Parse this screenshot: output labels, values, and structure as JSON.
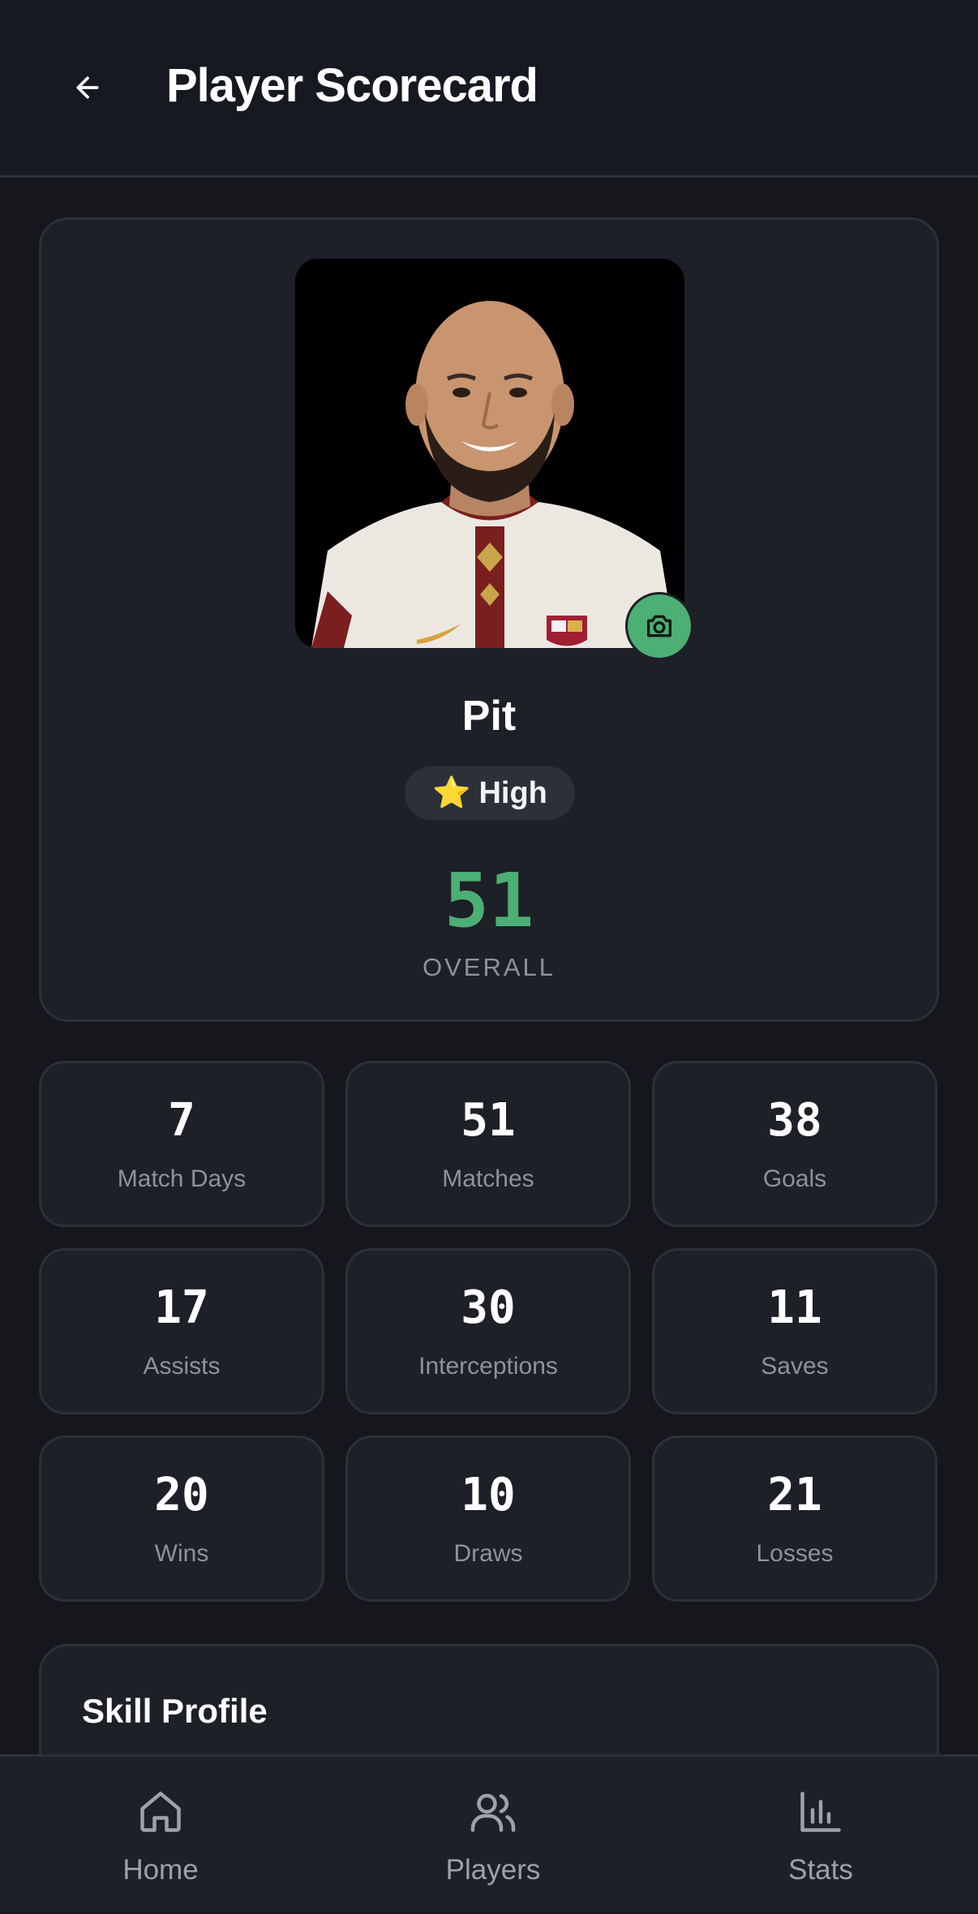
{
  "header": {
    "title": "Player Scorecard",
    "back_icon": "arrow-left-icon"
  },
  "profile": {
    "name": "Pit",
    "tier_emoji": "⭐",
    "tier_label": "High",
    "overall_value": "51",
    "overall_label": "OVERALL",
    "camera_icon": "camera-icon",
    "accent_color": "#4caf73"
  },
  "stats": [
    {
      "value": "7",
      "label": "Match Days"
    },
    {
      "value": "51",
      "label": "Matches"
    },
    {
      "value": "38",
      "label": "Goals"
    },
    {
      "value": "17",
      "label": "Assists"
    },
    {
      "value": "30",
      "label": "Interceptions"
    },
    {
      "value": "11",
      "label": "Saves"
    },
    {
      "value": "20",
      "label": "Wins"
    },
    {
      "value": "10",
      "label": "Draws"
    },
    {
      "value": "21",
      "label": "Losses"
    }
  ],
  "skill_profile": {
    "title": "Skill Profile"
  },
  "nav": {
    "items": [
      {
        "label": "Home",
        "icon": "home-icon"
      },
      {
        "label": "Players",
        "icon": "users-icon"
      },
      {
        "label": "Stats",
        "icon": "bar-chart-icon"
      }
    ]
  }
}
